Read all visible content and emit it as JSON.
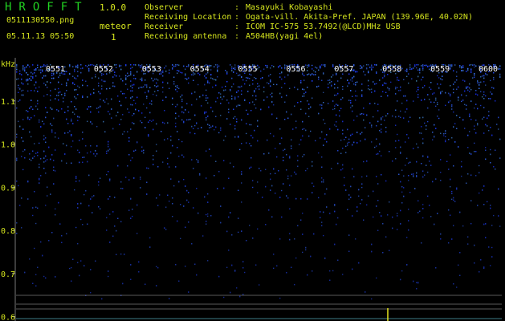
{
  "header": {
    "app_name": "HROFFT",
    "version": "1.0.0",
    "filename": "0511130550.png",
    "datetime": "05.11.13 05:50",
    "meteor_label": "meteor",
    "meteor_count": "1",
    "info": [
      {
        "key": "Observer",
        "sep": ":",
        "value": "Masayuki Kobayashi"
      },
      {
        "key": "Receiving Location",
        "sep": ":",
        "value": "Ogata-vill. Akita-Pref. JAPAN (139.96E, 40.02N)"
      },
      {
        "key": "Receiver",
        "sep": ":",
        "value": "ICOM IC-575 53.7492(@LCD)MHz USB"
      },
      {
        "key": "Receiving antenna",
        "sep": ":",
        "value": "A504HB(yagi 4el)"
      }
    ]
  },
  "chart_data": {
    "type": "heatmap",
    "ylabel": "kHz",
    "y_ticks": [
      "1.1",
      "1.0",
      "0.9",
      "0.8",
      "0.7",
      "0.6"
    ],
    "ylim": [
      0.59,
      1.2
    ],
    "time_labels": [
      "0551",
      "0552",
      "0553",
      "0554",
      "0555",
      "0556",
      "0557",
      "0558",
      "0559",
      "0600"
    ],
    "colors": {
      "noise": "#1e3cff",
      "text": "#d6e61e",
      "time": "#ffffff",
      "baseline": "#c8c8c8"
    }
  }
}
